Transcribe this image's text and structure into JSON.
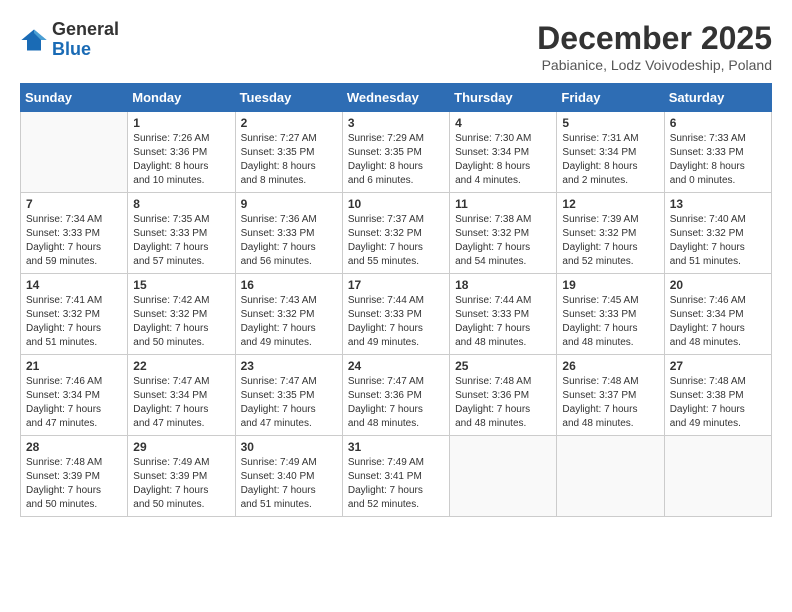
{
  "header": {
    "logo_general": "General",
    "logo_blue": "Blue",
    "month_title": "December 2025",
    "location": "Pabianice, Lodz Voivodeship, Poland"
  },
  "weekdays": [
    "Sunday",
    "Monday",
    "Tuesday",
    "Wednesday",
    "Thursday",
    "Friday",
    "Saturday"
  ],
  "weeks": [
    [
      {
        "day": "",
        "info": ""
      },
      {
        "day": "1",
        "info": "Sunrise: 7:26 AM\nSunset: 3:36 PM\nDaylight: 8 hours\nand 10 minutes."
      },
      {
        "day": "2",
        "info": "Sunrise: 7:27 AM\nSunset: 3:35 PM\nDaylight: 8 hours\nand 8 minutes."
      },
      {
        "day": "3",
        "info": "Sunrise: 7:29 AM\nSunset: 3:35 PM\nDaylight: 8 hours\nand 6 minutes."
      },
      {
        "day": "4",
        "info": "Sunrise: 7:30 AM\nSunset: 3:34 PM\nDaylight: 8 hours\nand 4 minutes."
      },
      {
        "day": "5",
        "info": "Sunrise: 7:31 AM\nSunset: 3:34 PM\nDaylight: 8 hours\nand 2 minutes."
      },
      {
        "day": "6",
        "info": "Sunrise: 7:33 AM\nSunset: 3:33 PM\nDaylight: 8 hours\nand 0 minutes."
      }
    ],
    [
      {
        "day": "7",
        "info": "Sunrise: 7:34 AM\nSunset: 3:33 PM\nDaylight: 7 hours\nand 59 minutes."
      },
      {
        "day": "8",
        "info": "Sunrise: 7:35 AM\nSunset: 3:33 PM\nDaylight: 7 hours\nand 57 minutes."
      },
      {
        "day": "9",
        "info": "Sunrise: 7:36 AM\nSunset: 3:33 PM\nDaylight: 7 hours\nand 56 minutes."
      },
      {
        "day": "10",
        "info": "Sunrise: 7:37 AM\nSunset: 3:32 PM\nDaylight: 7 hours\nand 55 minutes."
      },
      {
        "day": "11",
        "info": "Sunrise: 7:38 AM\nSunset: 3:32 PM\nDaylight: 7 hours\nand 54 minutes."
      },
      {
        "day": "12",
        "info": "Sunrise: 7:39 AM\nSunset: 3:32 PM\nDaylight: 7 hours\nand 52 minutes."
      },
      {
        "day": "13",
        "info": "Sunrise: 7:40 AM\nSunset: 3:32 PM\nDaylight: 7 hours\nand 51 minutes."
      }
    ],
    [
      {
        "day": "14",
        "info": "Sunrise: 7:41 AM\nSunset: 3:32 PM\nDaylight: 7 hours\nand 51 minutes."
      },
      {
        "day": "15",
        "info": "Sunrise: 7:42 AM\nSunset: 3:32 PM\nDaylight: 7 hours\nand 50 minutes."
      },
      {
        "day": "16",
        "info": "Sunrise: 7:43 AM\nSunset: 3:32 PM\nDaylight: 7 hours\nand 49 minutes."
      },
      {
        "day": "17",
        "info": "Sunrise: 7:44 AM\nSunset: 3:33 PM\nDaylight: 7 hours\nand 49 minutes."
      },
      {
        "day": "18",
        "info": "Sunrise: 7:44 AM\nSunset: 3:33 PM\nDaylight: 7 hours\nand 48 minutes."
      },
      {
        "day": "19",
        "info": "Sunrise: 7:45 AM\nSunset: 3:33 PM\nDaylight: 7 hours\nand 48 minutes."
      },
      {
        "day": "20",
        "info": "Sunrise: 7:46 AM\nSunset: 3:34 PM\nDaylight: 7 hours\nand 48 minutes."
      }
    ],
    [
      {
        "day": "21",
        "info": "Sunrise: 7:46 AM\nSunset: 3:34 PM\nDaylight: 7 hours\nand 47 minutes."
      },
      {
        "day": "22",
        "info": "Sunrise: 7:47 AM\nSunset: 3:34 PM\nDaylight: 7 hours\nand 47 minutes."
      },
      {
        "day": "23",
        "info": "Sunrise: 7:47 AM\nSunset: 3:35 PM\nDaylight: 7 hours\nand 47 minutes."
      },
      {
        "day": "24",
        "info": "Sunrise: 7:47 AM\nSunset: 3:36 PM\nDaylight: 7 hours\nand 48 minutes."
      },
      {
        "day": "25",
        "info": "Sunrise: 7:48 AM\nSunset: 3:36 PM\nDaylight: 7 hours\nand 48 minutes."
      },
      {
        "day": "26",
        "info": "Sunrise: 7:48 AM\nSunset: 3:37 PM\nDaylight: 7 hours\nand 48 minutes."
      },
      {
        "day": "27",
        "info": "Sunrise: 7:48 AM\nSunset: 3:38 PM\nDaylight: 7 hours\nand 49 minutes."
      }
    ],
    [
      {
        "day": "28",
        "info": "Sunrise: 7:48 AM\nSunset: 3:39 PM\nDaylight: 7 hours\nand 50 minutes."
      },
      {
        "day": "29",
        "info": "Sunrise: 7:49 AM\nSunset: 3:39 PM\nDaylight: 7 hours\nand 50 minutes."
      },
      {
        "day": "30",
        "info": "Sunrise: 7:49 AM\nSunset: 3:40 PM\nDaylight: 7 hours\nand 51 minutes."
      },
      {
        "day": "31",
        "info": "Sunrise: 7:49 AM\nSunset: 3:41 PM\nDaylight: 7 hours\nand 52 minutes."
      },
      {
        "day": "",
        "info": ""
      },
      {
        "day": "",
        "info": ""
      },
      {
        "day": "",
        "info": ""
      }
    ]
  ]
}
